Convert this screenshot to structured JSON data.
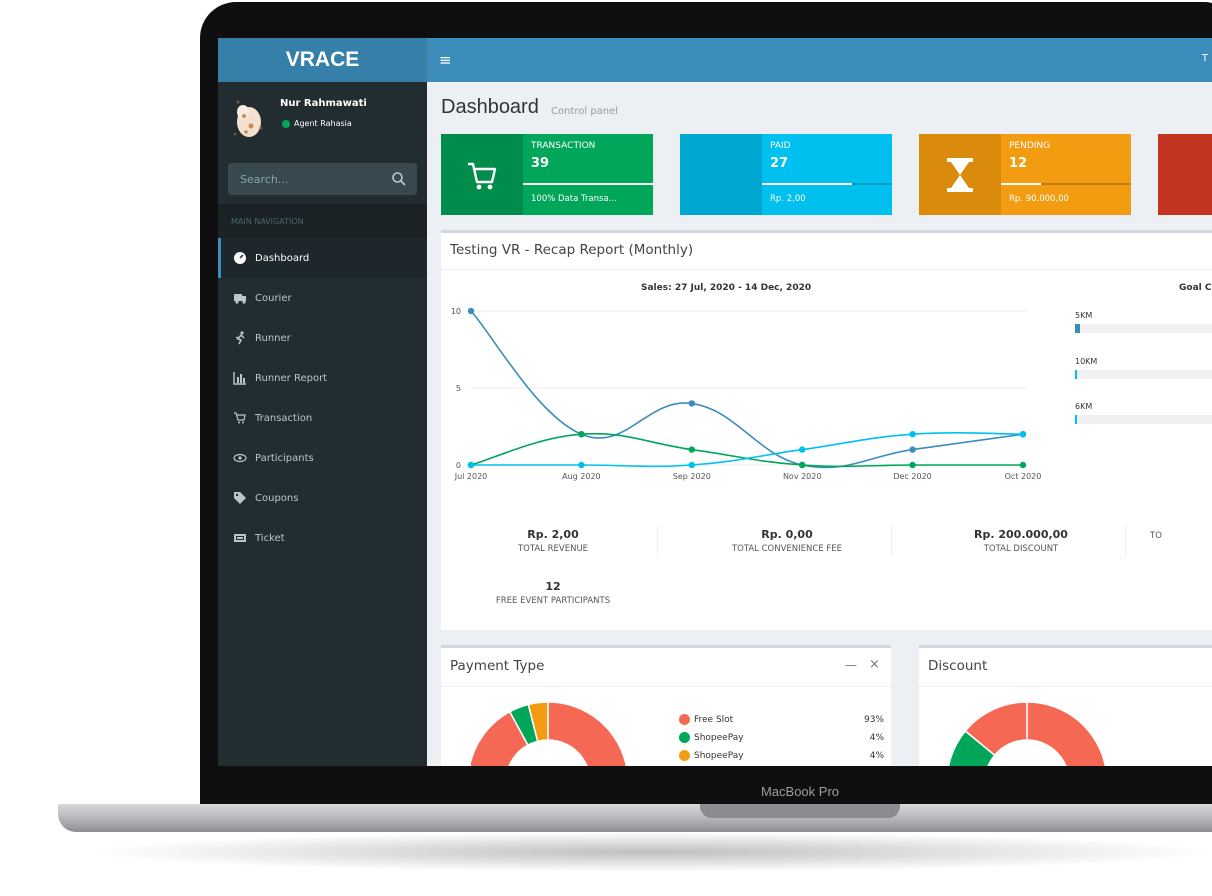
{
  "app": {
    "logo": "VRACE",
    "topbar_text": "T",
    "device_label": "MacBook Pro"
  },
  "user": {
    "name": "Nur Rahmawati",
    "status": "Agent Rahasia"
  },
  "search": {
    "placeholder": "Search..."
  },
  "nav": {
    "header": "MAIN NAVIGATION",
    "items": [
      {
        "label": "Dashboard",
        "icon": "dashboard-icon"
      },
      {
        "label": "Courier",
        "icon": "truck-icon"
      },
      {
        "label": "Runner",
        "icon": "runner-icon"
      },
      {
        "label": "Runner Report",
        "icon": "bar-chart-icon"
      },
      {
        "label": "Transaction",
        "icon": "cart-icon"
      },
      {
        "label": "Participants",
        "icon": "eye-icon"
      },
      {
        "label": "Coupons",
        "icon": "tag-icon"
      },
      {
        "label": "Ticket",
        "icon": "ticket-icon"
      }
    ]
  },
  "page": {
    "title": "Dashboard",
    "subtitle": "Control panel"
  },
  "info_boxes": [
    {
      "label": "TRANSACTION",
      "value": "39",
      "desc": "100% Data Transa...",
      "progress": 1.0,
      "icon": "cart-icon",
      "icon_color": "#008d4c",
      "color": "#00a65a"
    },
    {
      "label": "PAID",
      "value": "27",
      "desc": "Rp. 2,00",
      "progress": 0.69,
      "icon": "",
      "icon_color": "#00a7d0",
      "color": "#00c0ef"
    },
    {
      "label": "PENDING",
      "value": "12",
      "desc": "Rp. 90.000,00",
      "progress": 0.31,
      "icon": "hourglass-icon",
      "icon_color": "#db8b0b",
      "color": "#f39c12"
    },
    {
      "label": "",
      "value": "",
      "desc": "",
      "progress": 0,
      "icon": "",
      "icon_color": "#c23321",
      "color": "#dd4b39"
    }
  ],
  "recap": {
    "title": "Testing VR - Recap Report (Monthly)",
    "goal_title": "Goal C",
    "goals": [
      {
        "label": "5KM",
        "value": 0.03,
        "color": "#3c8dbc"
      },
      {
        "label": "10KM",
        "value": 0.012,
        "color": "#00c0ef"
      },
      {
        "label": "6KM",
        "value": 0.012,
        "color": "#00c0ef"
      }
    ],
    "stats": [
      {
        "value": "Rp. 2,00",
        "label": "TOTAL REVENUE"
      },
      {
        "value": "Rp. 0,00",
        "label": "TOTAL CONVENIENCE FEE"
      },
      {
        "value": "Rp. 200.000,00",
        "label": "TOTAL DISCOUNT"
      },
      {
        "value": "",
        "label": "TO"
      },
      {
        "value": "12",
        "label": "FREE EVENT PARTICIPANTS"
      }
    ]
  },
  "chart_data": {
    "type": "line",
    "title": "Sales: 27 Jul, 2020 - 14 Dec, 2020",
    "categories": [
      "Jul 2020",
      "Aug 2020",
      "Sep 2020",
      "Nov 2020",
      "Dec 2020",
      "Oct 2020"
    ],
    "ylim": [
      0,
      10
    ],
    "yticks": [
      0,
      5,
      10
    ],
    "series": [
      {
        "color": "#3c8dbc",
        "values": [
          10,
          2,
          4,
          0,
          1,
          2
        ]
      },
      {
        "color": "#00a65a",
        "values": [
          0,
          2,
          1,
          0,
          0,
          0
        ]
      },
      {
        "color": "#00c0ef",
        "values": [
          0,
          0,
          0,
          1,
          2,
          2
        ]
      }
    ]
  },
  "panels": {
    "payment": {
      "title": "Payment Type",
      "minimize": "—",
      "close": "×",
      "legend": [
        {
          "label": "Free Slot",
          "pct": "93%",
          "value": 93,
          "color": "#f56954"
        },
        {
          "label": "ShopeePay",
          "pct": "4%",
          "value": 4,
          "color": "#00a65a"
        },
        {
          "label": "ShopeePay",
          "pct": "4%",
          "value": 4,
          "color": "#f39c12"
        }
      ]
    },
    "discount": {
      "title": "Discount",
      "slices": [
        {
          "value": 60,
          "color": "#f56954"
        },
        {
          "value": 26,
          "color": "#00a65a"
        },
        {
          "value": 14,
          "color": "#f56954"
        }
      ]
    }
  }
}
